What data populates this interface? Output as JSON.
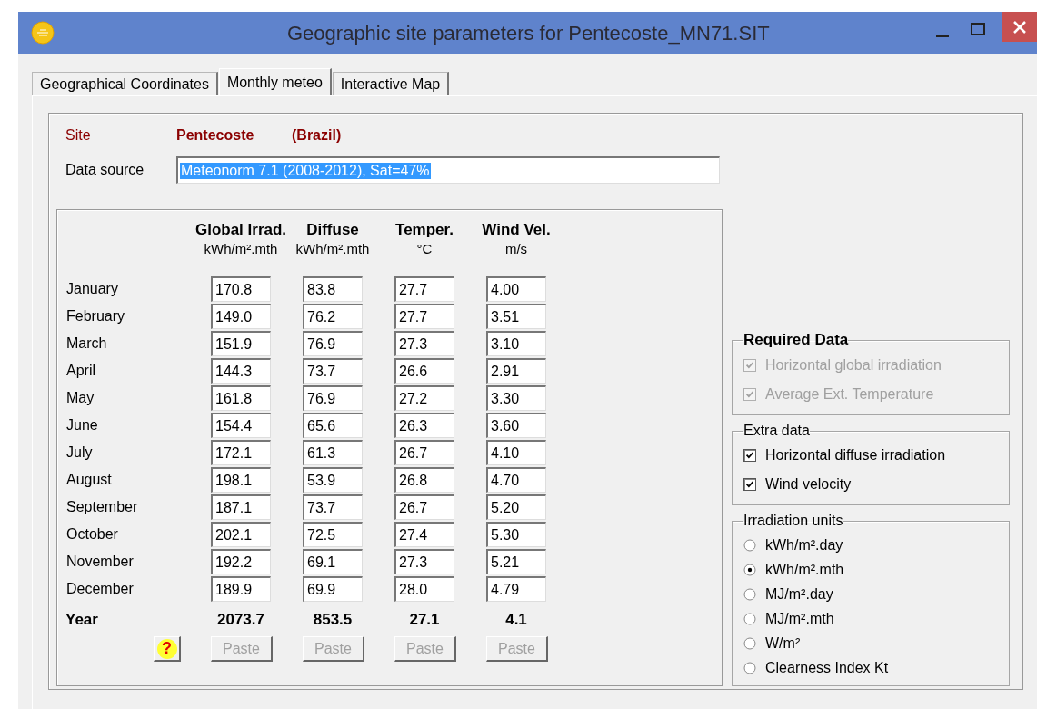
{
  "window": {
    "title": "Geographic site parameters for Pentecoste_MN71.SIT"
  },
  "tabs": [
    {
      "label": "Geographical Coordinates",
      "selected": false
    },
    {
      "label": "Monthly meteo",
      "selected": true
    },
    {
      "label": "Interactive Map",
      "selected": false
    }
  ],
  "site": {
    "label": "Site",
    "name": "Pentecoste",
    "country": "(Brazil)"
  },
  "data_source": {
    "label": "Data source",
    "value": "Meteonorm 7.1 (2008-2012), Sat=47%",
    "text_selected": true
  },
  "table": {
    "columns": [
      {
        "title": "Global Irrad.",
        "unit": "kWh/m².mth"
      },
      {
        "title": "Diffuse",
        "unit": "kWh/m².mth"
      },
      {
        "title": "Temper.",
        "unit": "°C"
      },
      {
        "title": "Wind Vel.",
        "unit": "m/s"
      }
    ],
    "rows": [
      {
        "month": "January",
        "values": [
          "170.8",
          "83.8",
          "27.7",
          "4.00"
        ]
      },
      {
        "month": "February",
        "values": [
          "149.0",
          "76.2",
          "27.7",
          "3.51"
        ]
      },
      {
        "month": "March",
        "values": [
          "151.9",
          "76.9",
          "27.3",
          "3.10"
        ]
      },
      {
        "month": "April",
        "values": [
          "144.3",
          "73.7",
          "26.6",
          "2.91"
        ]
      },
      {
        "month": "May",
        "values": [
          "161.8",
          "76.9",
          "27.2",
          "3.30"
        ]
      },
      {
        "month": "June",
        "values": [
          "154.4",
          "65.6",
          "26.3",
          "3.60"
        ]
      },
      {
        "month": "July",
        "values": [
          "172.1",
          "61.3",
          "26.7",
          "4.10"
        ]
      },
      {
        "month": "August",
        "values": [
          "198.1",
          "53.9",
          "26.8",
          "4.70"
        ]
      },
      {
        "month": "September",
        "values": [
          "187.1",
          "73.7",
          "26.7",
          "5.20"
        ]
      },
      {
        "month": "October",
        "values": [
          "202.1",
          "72.5",
          "27.4",
          "5.30"
        ]
      },
      {
        "month": "November",
        "values": [
          "192.2",
          "69.1",
          "27.3",
          "5.21"
        ]
      },
      {
        "month": "December",
        "values": [
          "189.9",
          "69.9",
          "28.0",
          "4.79"
        ]
      }
    ],
    "totals": {
      "label": "Year",
      "values": [
        "2073.7",
        "853.5",
        "27.1",
        "4.1"
      ]
    },
    "help_button": {
      "label": "?"
    },
    "paste_buttons": [
      {
        "label": "Paste",
        "disabled": true
      },
      {
        "label": "Paste",
        "disabled": true
      },
      {
        "label": "Paste",
        "disabled": true
      },
      {
        "label": "Paste",
        "disabled": true
      }
    ]
  },
  "required_data": {
    "title": "Required Data",
    "items": [
      {
        "label": "Horizontal global irradiation",
        "checked": true,
        "disabled": true
      },
      {
        "label": "Average Ext. Temperature",
        "checked": true,
        "disabled": true
      }
    ]
  },
  "extra_data": {
    "title": "Extra data",
    "items": [
      {
        "label": "Horizontal diffuse irradiation",
        "checked": true,
        "disabled": false
      },
      {
        "label": "Wind velocity",
        "checked": true,
        "disabled": false
      }
    ]
  },
  "irradiation_units": {
    "title": "Irradiation units",
    "options": [
      {
        "label": "kWh/m².day",
        "selected": false
      },
      {
        "label": "kWh/m².mth",
        "selected": true
      },
      {
        "label": "MJ/m².day",
        "selected": false
      },
      {
        "label": "MJ/m².mth",
        "selected": false
      },
      {
        "label": "W/m²",
        "selected": false
      },
      {
        "label": "Clearness Index Kt",
        "selected": false
      }
    ]
  }
}
